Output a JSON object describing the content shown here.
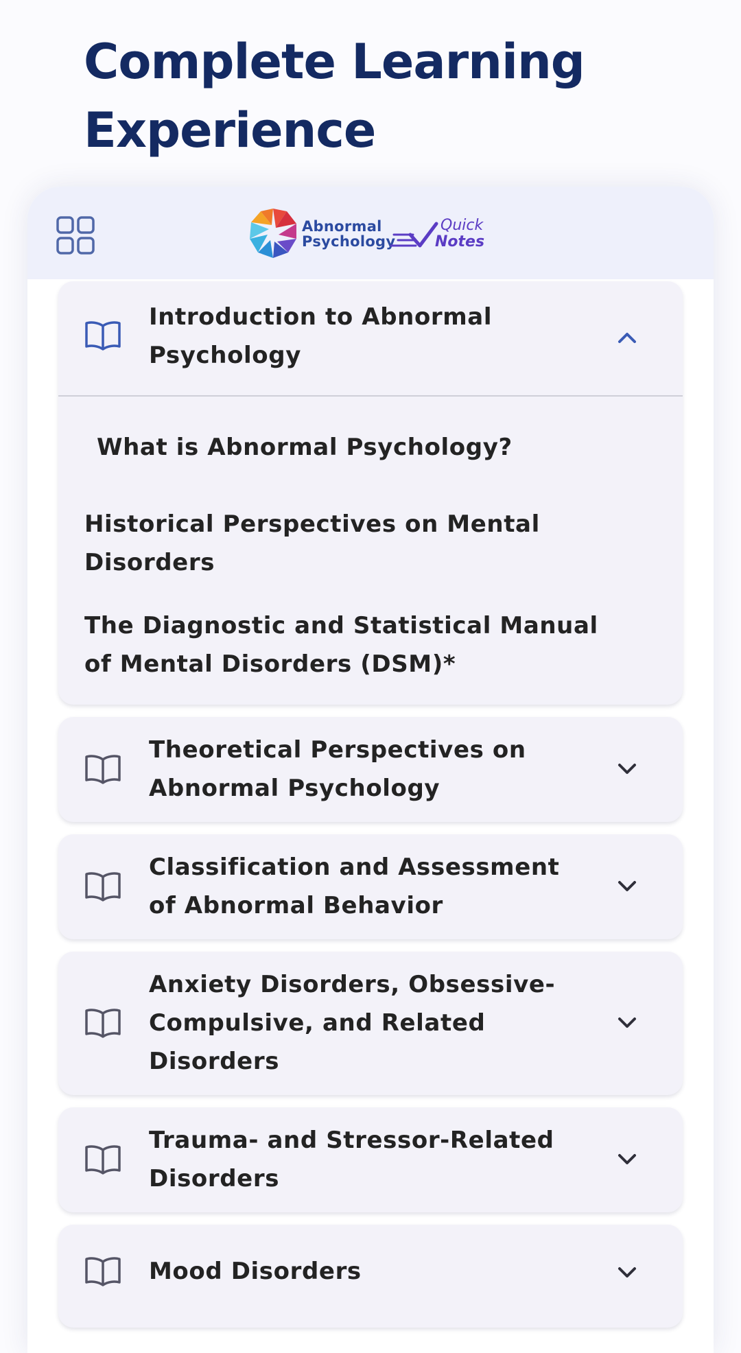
{
  "headline": {
    "line1": "Complete Learning",
    "line2": "Experience"
  },
  "app": {
    "logo": {
      "name_line1": "Abnormal",
      "name_line2": "Psychology",
      "tag_line1": "Quick",
      "tag_line2": "Notes"
    },
    "menu_icon": "grid-icon"
  },
  "chapters": [
    {
      "title": "Introduction to Abnormal Psychology",
      "expanded": true,
      "topics": [
        "What is Abnormal Psychology?",
        "Historical Perspectives on Mental Disorders",
        "The Diagnostic and Statistical Manual of Mental Disorders (DSM)*"
      ]
    },
    {
      "title": "Theoretical Perspectives on Abnormal Psychology",
      "expanded": false
    },
    {
      "title": "Classification and Assessment of Abnormal Behavior",
      "expanded": false
    },
    {
      "title": "Anxiety Disorders, Obsessive-Compulsive, and Related Disorders",
      "expanded": false
    },
    {
      "title": "Trauma- and Stressor-Related Disorders",
      "expanded": false
    },
    {
      "title": "Mood Disorders",
      "expanded": false
    }
  ],
  "colors": {
    "headline": "#142a62",
    "accent_blue": "#3a5bb5",
    "card_bg": "#f3f2f9",
    "topbar_bg": "#eef0fb"
  },
  "icons": {
    "chapter_icon": "book-open-icon",
    "expanded_icon": "chevron-up-icon",
    "collapsed_icon": "chevron-down-icon"
  }
}
